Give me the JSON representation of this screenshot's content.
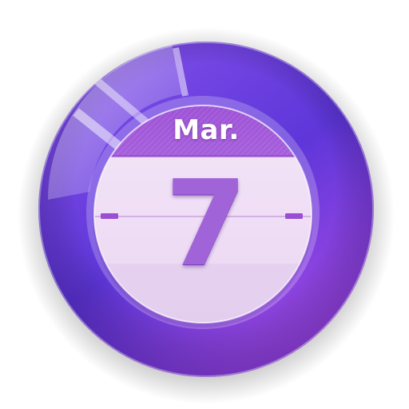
{
  "icon": {
    "name": "calendar-icon",
    "month": "Mar.",
    "day": "7",
    "colors": {
      "disc_dark": "#5b34d6",
      "disc_light": "#a24be3",
      "header": "#a258db",
      "page": "#f1e2f6",
      "digit": "#a064d8",
      "ring_marks": "#9a4ed4"
    }
  }
}
